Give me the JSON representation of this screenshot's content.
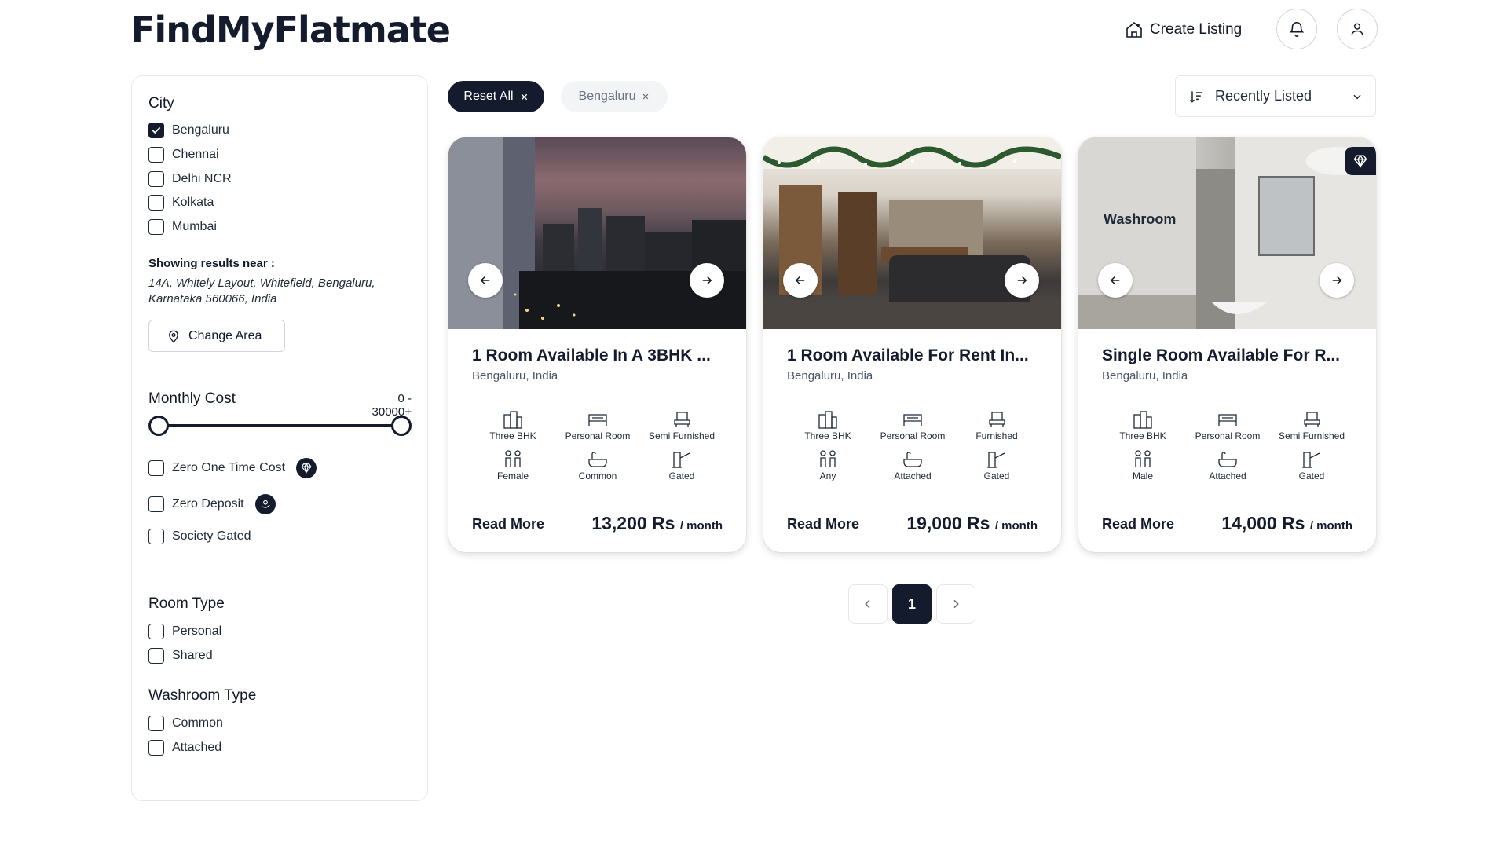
{
  "header": {
    "logo": "FindMyFlatmate",
    "create_listing": "Create Listing"
  },
  "sidebar": {
    "city_title": "City",
    "cities": [
      {
        "label": "Bengaluru",
        "checked": true
      },
      {
        "label": "Chennai",
        "checked": false
      },
      {
        "label": "Delhi NCR",
        "checked": false
      },
      {
        "label": "Kolkata",
        "checked": false
      },
      {
        "label": "Mumbai",
        "checked": false
      }
    ],
    "near_label": "Showing results near :",
    "near_address": "14A, Whitely Layout, Whitefield, Bengaluru, Karnataka 560066, India",
    "change_area": "Change Area",
    "monthly_cost_title": "Monthly Cost",
    "monthly_cost_range": "0 - 30000+",
    "cost_filters": [
      {
        "label": "Zero One Time Cost",
        "checked": false
      },
      {
        "label": "Zero Deposit",
        "checked": false
      },
      {
        "label": "Society Gated",
        "checked": false
      }
    ],
    "room_type_title": "Room Type",
    "room_types": [
      {
        "label": "Personal",
        "checked": false
      },
      {
        "label": "Shared",
        "checked": false
      }
    ],
    "washroom_type_title": "Washroom Type",
    "washroom_types": [
      {
        "label": "Common",
        "checked": false
      },
      {
        "label": "Attached",
        "checked": false
      }
    ]
  },
  "filters": {
    "reset_all": "Reset All",
    "active_city": "Bengaluru",
    "sort_label": "Recently Listed"
  },
  "listings": [
    {
      "title": "1 Room Available In A 3BHK ...",
      "location": "Bengaluru, India",
      "bhk": "Three BHK",
      "room": "Personal Room",
      "furnishing": "Semi Furnished",
      "gender": "Female",
      "washroom": "Common",
      "society": "Gated",
      "read_more": "Read More",
      "price": "13,200 Rs",
      "per": "/ month",
      "premium": false
    },
    {
      "title": "1 Room Available For Rent In...",
      "location": "Bengaluru, India",
      "bhk": "Three BHK",
      "room": "Personal Room",
      "furnishing": "Furnished",
      "gender": "Any",
      "washroom": "Attached",
      "society": "Gated",
      "read_more": "Read More",
      "price": "19,000 Rs",
      "per": "/ month",
      "premium": false
    },
    {
      "title": "Single Room Available For R...",
      "location": "Bengaluru, India",
      "image_caption": "Washroom",
      "bhk": "Three BHK",
      "room": "Personal Room",
      "furnishing": "Semi Furnished",
      "gender": "Male",
      "washroom": "Attached",
      "society": "Gated",
      "read_more": "Read More",
      "price": "14,000 Rs",
      "per": "/ month",
      "premium": true
    }
  ],
  "pagination": {
    "current": "1"
  },
  "colors": {
    "primary": "#141b2d",
    "border": "#e5e7eb",
    "muted": "#6b7280"
  }
}
